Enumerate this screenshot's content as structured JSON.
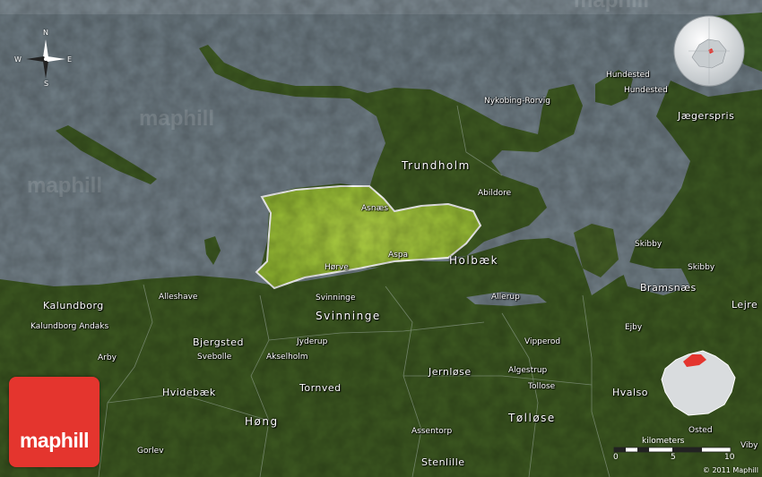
{
  "map": {
    "compass": {
      "n": "N",
      "s": "S",
      "e": "E",
      "w": "W"
    },
    "watermark": "maphill",
    "places": {
      "hundested_1": "Hundested",
      "hundested_2": "Hundested",
      "jagerspris": "Jægerspris",
      "nykobing": "Nykobing-Rorvig",
      "trundholm": "Trundholm",
      "abildore": "Abildore",
      "asnas": "Asnæs",
      "aspa": "Aspa",
      "horve": "Hørve",
      "holbak": "Holbæk",
      "skibby_1": "Skibby",
      "skibby_2": "Skibby",
      "svinninge_small": "Svinninge",
      "svinninge_big": "Svinninge",
      "alleshave": "Alleshave",
      "allerup": "Allerup",
      "kalundborg_big": "Kalundborg",
      "kalundborg_andaks": "Kalundborg Andaks",
      "bramsnas": "Bramsnæs",
      "lejre": "Lejre",
      "ejby": "Ejby",
      "bjergsted": "Bjergsted",
      "jyderup": "Jyderup",
      "svebolle": "Svebolle",
      "akselholm": "Akselholm",
      "vipperod": "Vipperod",
      "arby": "Arby",
      "jernlose": "Jernløse",
      "algestrup": "Algestrup",
      "tollose_small": "Tollose",
      "hvidebak": "Hvidebæk",
      "tornved": "Tornved",
      "hvalso": "Hvalso",
      "hong": "Høng",
      "tollose_big": "Tølløse",
      "assentorp": "Assentorp",
      "gorlev": "Gorlev",
      "stenlille": "Stenlille",
      "osted": "Osted",
      "viby": "Viby"
    },
    "scale": {
      "title": "kilometers",
      "ticks": [
        "0",
        "5",
        "10"
      ]
    },
    "logo": "maphill",
    "copyright": "© 2011 Maphill"
  },
  "colors": {
    "water": "#727f87",
    "land": "#3e5a22",
    "highlight": "#a9cc3c",
    "logo": "#e4352e"
  }
}
